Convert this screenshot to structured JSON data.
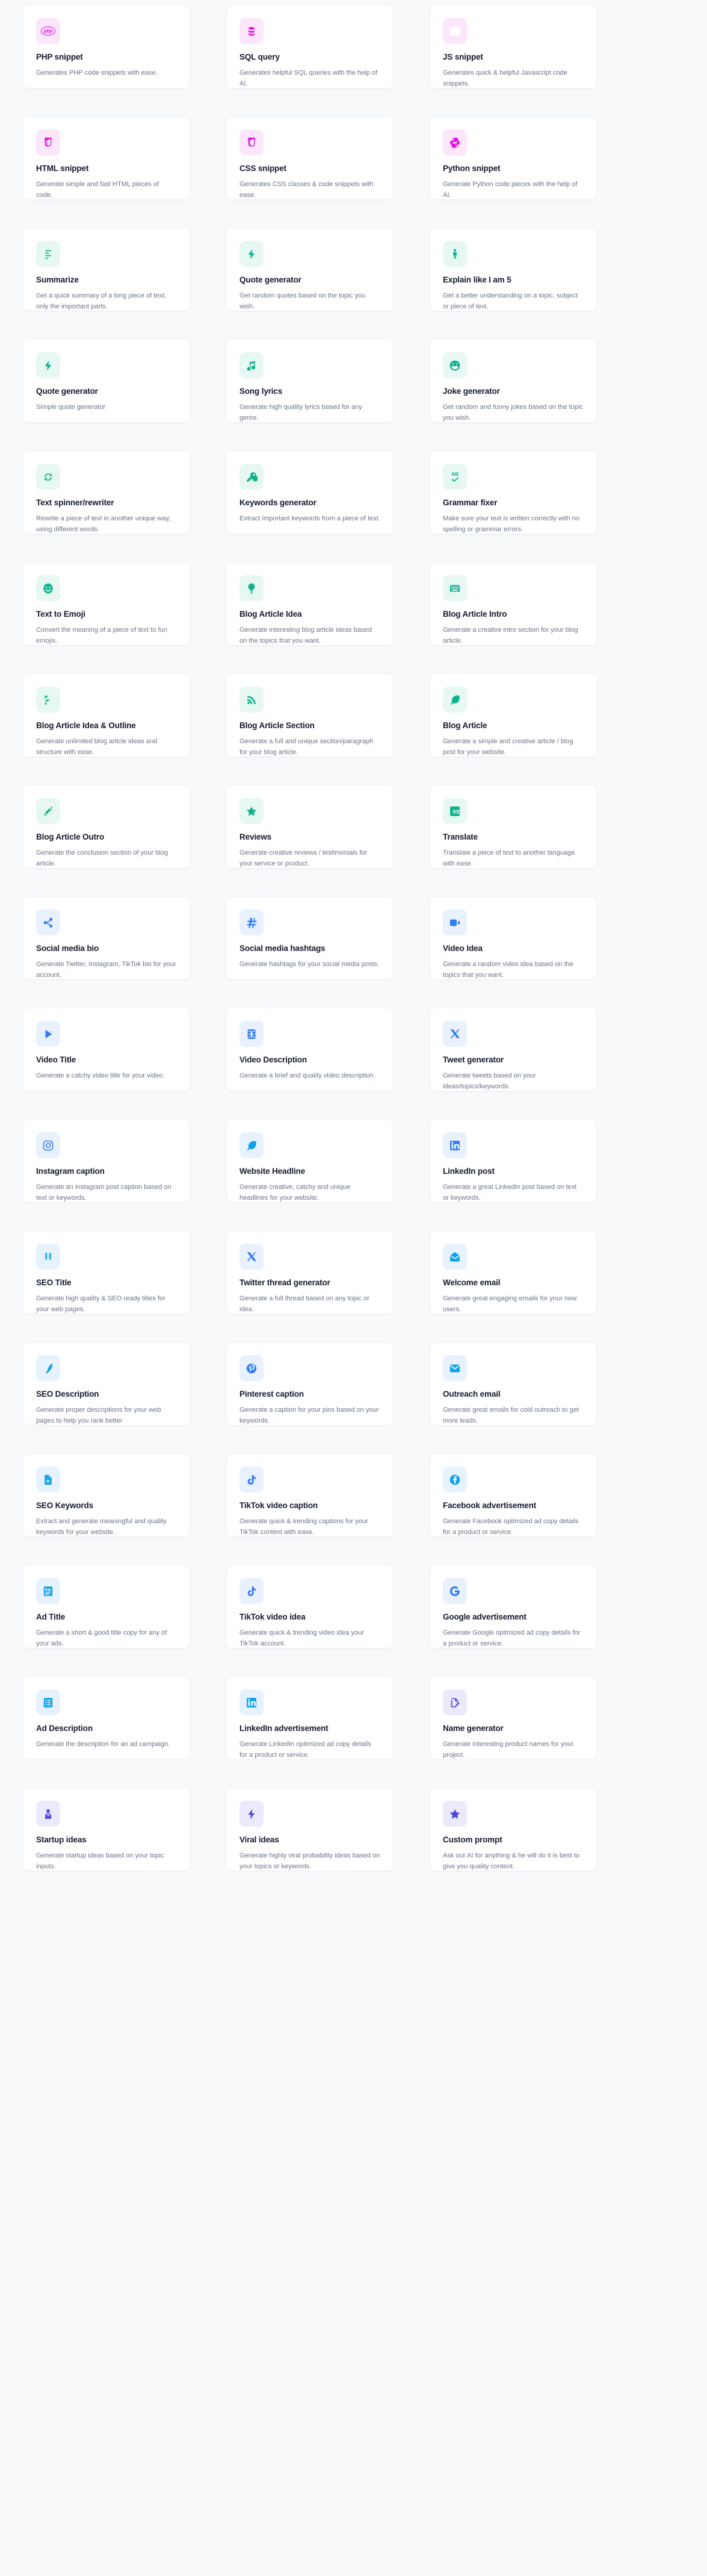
{
  "page": {
    "background_color": "#f7f9fb",
    "card_background": "#ffffff",
    "title_color": "#15192c",
    "description_color": "#6b7488",
    "columns": 3
  },
  "palette": {
    "magenta": {
      "bg": "#fbe6fb",
      "fg": "#e609e6"
    },
    "teal": {
      "bg": "#e7f8f3",
      "fg": "#0eb48e"
    },
    "blue": {
      "bg": "#e9f1fe",
      "fg": "#2f7cf6"
    },
    "sky": {
      "bg": "#e6f3fe",
      "fg": "#11a2ee"
    },
    "indigo": {
      "bg": "#eaeafc",
      "fg": "#4f45e4"
    }
  },
  "cards": [
    {
      "title": "PHP snippet",
      "description": "Generates PHP code snippets with ease.",
      "icon": "php-icon",
      "tone": "magenta"
    },
    {
      "title": "SQL query",
      "description": "Generates helpful SQL queries with the help of AI.",
      "icon": "database-icon",
      "tone": "magenta"
    },
    {
      "title": "JS snippet",
      "description": "Generates quick & helpful Javascript code snippets.",
      "icon": "javascript-icon",
      "tone": "magenta"
    },
    {
      "title": "HTML snippet",
      "description": "Generate simple and fast HTML pieces of code.",
      "icon": "html5-icon",
      "tone": "magenta"
    },
    {
      "title": "CSS snippet",
      "description": "Generates CSS classes & code snippets with ease.",
      "icon": "css3-icon",
      "tone": "magenta"
    },
    {
      "title": "Python snippet",
      "description": "Generate Python code pieces with the help of AI.",
      "icon": "python-icon",
      "tone": "magenta"
    },
    {
      "title": "Summarize",
      "description": "Get a quick summary of a long piece of text, only the important parts.",
      "icon": "text-lines-icon",
      "tone": "teal"
    },
    {
      "title": "Quote generator",
      "description": "Get random quotes based on the topic you wish.",
      "icon": "bolt-icon",
      "tone": "teal"
    },
    {
      "title": "Explain like I am 5",
      "description": "Get a better understanding on a topic, subject or piece of text.",
      "icon": "child-icon",
      "tone": "teal"
    },
    {
      "title": "Quote generator",
      "description": "Simple quote generator",
      "icon": "bolt-icon",
      "tone": "teal"
    },
    {
      "title": "Song lyrics",
      "description": "Generate high quality lyrics based for any genre.",
      "icon": "music-note-icon",
      "tone": "teal"
    },
    {
      "title": "Joke generator",
      "description": "Get random and funny jokes based on the topic you wish.",
      "icon": "laughing-face-icon",
      "tone": "teal"
    },
    {
      "title": "Text spinner/rewriter",
      "description": "Rewrite a piece of text in another unique way, using different words.",
      "icon": "refresh-cycle-icon",
      "tone": "teal"
    },
    {
      "title": "Keywords generator",
      "description": "Extract important keywords from a piece of text.",
      "icon": "key-icon",
      "tone": "teal"
    },
    {
      "title": "Grammar fixer",
      "description": "Make sure your text is written correctly with no spelling or grammar errors.",
      "icon": "spellcheck-icon",
      "tone": "teal"
    },
    {
      "title": "Text to Emoji",
      "description": "Convert the meaning of a piece of text to fun emojis.",
      "icon": "smiley-face-icon",
      "tone": "teal"
    },
    {
      "title": "Blog Article Idea",
      "description": "Generate interesting blog article ideas based on the topics that you want.",
      "icon": "lightbulb-icon",
      "tone": "teal"
    },
    {
      "title": "Blog Article Intro",
      "description": "Generate a creative intro section for your blog article.",
      "icon": "keyboard-icon",
      "tone": "teal"
    },
    {
      "title": "Blog Article Idea & Outline",
      "description": "Generate unlimited blog article ideas and structure with ease.",
      "icon": "blogger-icon",
      "tone": "teal"
    },
    {
      "title": "Blog Article Section",
      "description": "Generate a full and unique section/paragraph for your blog article.",
      "icon": "rss-icon",
      "tone": "teal"
    },
    {
      "title": "Blog Article",
      "description": "Generate a simple and creative article / blog post for your website.",
      "icon": "feather-icon",
      "tone": "teal"
    },
    {
      "title": "Blog Article Outro",
      "description": "Generate the conclusion section of your blog article.",
      "icon": "fountain-pen-icon",
      "tone": "teal"
    },
    {
      "title": "Reviews",
      "description": "Generate creative reviews / testimonials for your service or product.",
      "icon": "star-icon",
      "tone": "teal"
    },
    {
      "title": "Translate",
      "description": "Translate a piece of text to another language with ease.",
      "icon": "translate-icon",
      "tone": "teal"
    },
    {
      "title": "Social media bio",
      "description": "Generate Twitter, Instagram, TikTok bio for your account.",
      "icon": "share-nodes-icon",
      "tone": "blue"
    },
    {
      "title": "Social media hashtags",
      "description": "Generate hashtags for your social media posts.",
      "icon": "hashtag-icon",
      "tone": "blue"
    },
    {
      "title": "Video Idea",
      "description": "Generate a random video idea based on the topics that you want.",
      "icon": "video-camera-icon",
      "tone": "blue"
    },
    {
      "title": "Video Title",
      "description": "Generate a catchy video title for your video.",
      "icon": "play-icon",
      "tone": "blue"
    },
    {
      "title": "Video Description",
      "description": "Generate a brief and quality video description.",
      "icon": "film-strip-icon",
      "tone": "blue"
    },
    {
      "title": "Tweet generator",
      "description": "Generate tweets based on your ideas/topics/keywords.",
      "icon": "x-twitter-icon",
      "tone": "blue"
    },
    {
      "title": "Instagram caption",
      "description": "Generate an instagram post caption based on text or keywords.",
      "icon": "instagram-icon",
      "tone": "blue"
    },
    {
      "title": "Website Headline",
      "description": "Generate creative, catchy and unique headlines for your website.",
      "icon": "feather-icon",
      "tone": "sky"
    },
    {
      "title": "LinkedIn post",
      "description": "Generate a great LinkedIn post based on text or keywords.",
      "icon": "linkedin-icon",
      "tone": "blue"
    },
    {
      "title": "SEO Title",
      "description": "Generate high quality & SEO ready titles for your web pages.",
      "icon": "heading-icon",
      "tone": "sky"
    },
    {
      "title": "Twitter thread generator",
      "description": "Generate a full thread based on any topic or idea.",
      "icon": "x-twitter-icon",
      "tone": "blue"
    },
    {
      "title": "Welcome email",
      "description": "Generate great engaging emails for your new users.",
      "icon": "envelope-open-icon",
      "tone": "sky"
    },
    {
      "title": "SEO Description",
      "description": "Generate proper descriptions for your web pages to help you rank better",
      "icon": "pen-icon",
      "tone": "sky"
    },
    {
      "title": "Pinterest caption",
      "description": "Generate a caption for your pins based on your keywords.",
      "icon": "pinterest-icon",
      "tone": "blue"
    },
    {
      "title": "Outreach email",
      "description": "Generate great emails for cold outreach to get more leads.",
      "icon": "envelope-icon",
      "tone": "sky"
    },
    {
      "title": "SEO Keywords",
      "description": "Extract and generate meaningful and quality keywords for your website.",
      "icon": "word-document-icon",
      "tone": "sky"
    },
    {
      "title": "TikTok video caption",
      "description": "Generate quick & trending captions for your TikTok content with ease.",
      "icon": "tiktok-icon",
      "tone": "blue"
    },
    {
      "title": "Facebook advertisement",
      "description": "Generate Facebook optimized ad copy details for a product or service.",
      "icon": "facebook-icon",
      "tone": "sky"
    },
    {
      "title": "Ad Title",
      "description": "Generate a short & good title copy for any of your ads.",
      "icon": "invoice-icon",
      "tone": "sky"
    },
    {
      "title": "TikTok video idea",
      "description": "Generate quick & trending video idea your TikTok account.",
      "icon": "tiktok-icon",
      "tone": "blue"
    },
    {
      "title": "Google advertisement",
      "description": "Generate Google optimized ad copy details for a product or service.",
      "icon": "google-icon",
      "tone": "blue"
    },
    {
      "title": "Ad Description",
      "description": "Generate the description for an ad campaign.",
      "icon": "list-box-icon",
      "tone": "sky"
    },
    {
      "title": "LinkedIn advertisement",
      "description": "Generate LinkedIn optimized ad copy details for a product or service.",
      "icon": "linkedin-icon",
      "tone": "sky"
    },
    {
      "title": "Name generator",
      "description": "Generate interesting product names for your project.",
      "icon": "signature-icon",
      "tone": "indigo"
    },
    {
      "title": "Startup ideas",
      "description": "Generate startup ideas based on your topic inputs.",
      "icon": "businessperson-icon",
      "tone": "indigo"
    },
    {
      "title": "Viral ideas",
      "description": "Generate highly viral probability ideas based on your topics or keywords.",
      "icon": "bolt-icon",
      "tone": "indigo"
    },
    {
      "title": "Custom prompt",
      "description": "Ask our AI for anything & he will do it is best to give you quality content.",
      "icon": "star-icon",
      "tone": "indigo"
    }
  ]
}
